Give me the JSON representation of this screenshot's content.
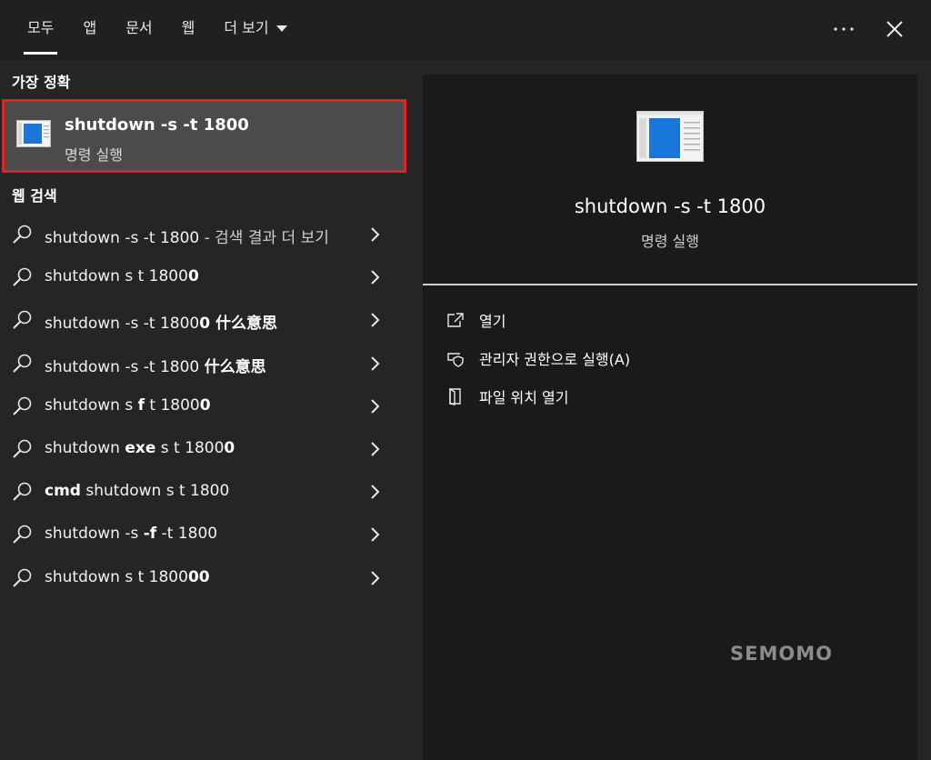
{
  "tabs": [
    {
      "label": "모두"
    },
    {
      "label": "앱"
    },
    {
      "label": "문서"
    },
    {
      "label": "웹"
    },
    {
      "label": "더 보기"
    }
  ],
  "header_icons": {
    "more": "more-horizontal-icon",
    "close": "close-icon"
  },
  "best_match": {
    "section_label": "가장 정확",
    "title": "shutdown -s -t 1800",
    "subtitle": "명령 실행",
    "icon": "run-command-app-icon"
  },
  "web_search": {
    "section_label": "웹 검색",
    "results": [
      {
        "parts": [
          {
            "t": "shutdown -s -t 1800",
            "b": false
          },
          {
            "t": " - 검색 결과 더 보기",
            "b": false,
            "sub": true
          }
        ]
      },
      {
        "parts": [
          {
            "t": "shutdown s t 1800",
            "b": false
          },
          {
            "t": "0",
            "b": true
          }
        ]
      },
      {
        "parts": [
          {
            "t": "shutdown -s -t 1800",
            "b": false
          },
          {
            "t": "0 什么意思",
            "b": true
          }
        ]
      },
      {
        "parts": [
          {
            "t": "shutdown -s -t 1800 ",
            "b": false
          },
          {
            "t": "什么意思",
            "b": true
          }
        ]
      },
      {
        "parts": [
          {
            "t": "shutdown s ",
            "b": false
          },
          {
            "t": "f",
            "b": true
          },
          {
            "t": " t 1800",
            "b": false
          },
          {
            "t": "0",
            "b": true
          }
        ]
      },
      {
        "parts": [
          {
            "t": "shutdown ",
            "b": false
          },
          {
            "t": "exe",
            "b": true
          },
          {
            "t": " s t 1800",
            "b": false
          },
          {
            "t": "0",
            "b": true
          }
        ]
      },
      {
        "parts": [
          {
            "t": "cmd",
            "b": true
          },
          {
            "t": " shutdown s t 1800",
            "b": false
          }
        ]
      },
      {
        "parts": [
          {
            "t": "shutdown -s ",
            "b": false
          },
          {
            "t": "-f",
            "b": true
          },
          {
            "t": " -t 1800",
            "b": false
          }
        ]
      },
      {
        "parts": [
          {
            "t": "shutdown s t 1800",
            "b": false
          },
          {
            "t": "00",
            "b": true
          }
        ]
      }
    ]
  },
  "preview": {
    "title": "shutdown -s -t 1800",
    "subtitle": "명령 실행",
    "actions": [
      {
        "label": "열기",
        "icon": "open-icon"
      },
      {
        "label": "관리자 권한으로 실행(A)",
        "icon": "run-as-admin-shield-icon"
      },
      {
        "label": "파일 위치 열기",
        "icon": "file-location-icon"
      }
    ]
  },
  "watermark": "SEMOMO",
  "colors": {
    "highlight_border": "#e0242a",
    "accent_blue": "#1a75d9"
  }
}
